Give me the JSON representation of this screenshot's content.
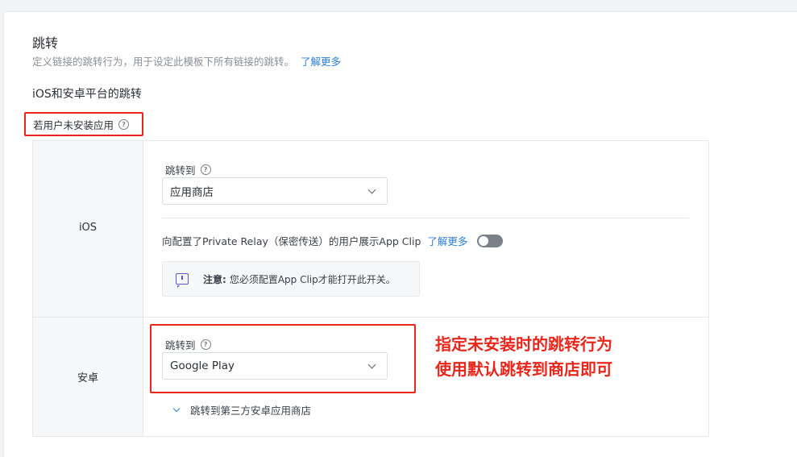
{
  "section": {
    "title": "跳转",
    "description": "定义链接的跳转行为，用于设定此模板下所有链接的跳转。",
    "learn_more": "了解更多"
  },
  "platforms_title": "iOS和安卓平台的跳转",
  "if_not_installed": {
    "label": "若用户未安装应用",
    "help_icon": "question-circle-icon"
  },
  "ios": {
    "label": "iOS",
    "redirect_label": "跳转到",
    "redirect_value": "应用商店",
    "relay_text": "向配置了Private Relay（保密传送）的用户展示App Clip",
    "relay_learn_more": "了解更多",
    "relay_toggle_on": false,
    "notice_icon": "message-alert-icon",
    "notice_bold": "注意:",
    "notice_text": "您必须配置App Clip才能打开此开关。"
  },
  "android": {
    "label": "安卓",
    "redirect_label": "跳转到",
    "redirect_value": "Google Play",
    "third_party": "跳转到第三方安卓应用商店"
  },
  "annotation": {
    "line1": "指定未安装时的跳转行为",
    "line2": "使用默认跳转到商店即可"
  },
  "colors": {
    "accent": "#2f7fd6",
    "annotation": "#e8261c"
  }
}
